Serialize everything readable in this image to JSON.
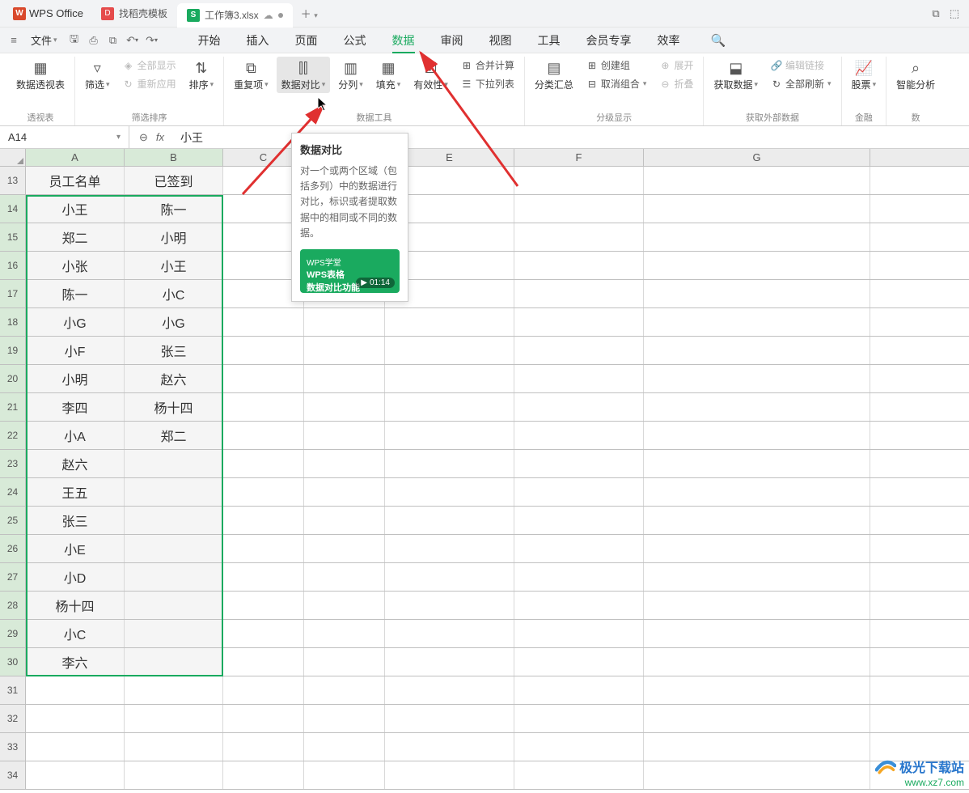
{
  "app": {
    "name": "WPS Office"
  },
  "tabs": {
    "find_template": "找稻壳模板",
    "file": {
      "name": "工作簿3.xlsx"
    }
  },
  "menubar": {
    "file": "文件",
    "items": [
      "开始",
      "插入",
      "页面",
      "公式",
      "数据",
      "审阅",
      "视图",
      "工具",
      "会员专享",
      "效率"
    ],
    "active_index": 4
  },
  "ribbon": {
    "groups": [
      {
        "label": "透视表",
        "buttons": [
          {
            "label": "数据透视表",
            "icon": "pivot"
          }
        ]
      },
      {
        "label": "筛选排序",
        "buttons": [
          {
            "label": "筛选",
            "icon": "filter",
            "dd": true
          },
          {
            "col": [
              {
                "label": "全部显示",
                "icon": "show-all",
                "disabled": true
              },
              {
                "label": "重新应用",
                "icon": "reapply",
                "disabled": true
              }
            ]
          },
          {
            "label": "排序",
            "icon": "sort",
            "dd": true
          }
        ]
      },
      {
        "label": "数据工具",
        "buttons": [
          {
            "label": "重复项",
            "icon": "dup",
            "dd": true
          },
          {
            "label": "数据对比",
            "icon": "compare",
            "dd": true,
            "active": true
          },
          {
            "label": "分列",
            "icon": "split",
            "dd": true
          },
          {
            "label": "填充",
            "icon": "fill",
            "dd": true
          },
          {
            "label": "有效性",
            "icon": "valid",
            "dd": true
          },
          {
            "col": [
              {
                "label": "合并计算",
                "icon": "merge"
              },
              {
                "label": "下拉列表",
                "icon": "dropdown"
              }
            ]
          }
        ]
      },
      {
        "label": "分级显示",
        "buttons": [
          {
            "label": "分类汇总",
            "icon": "subtotal"
          },
          {
            "col": [
              {
                "label": "创建组",
                "icon": "group"
              },
              {
                "label": "取消组合",
                "icon": "ungroup",
                "dd": true
              }
            ]
          },
          {
            "col": [
              {
                "label": "展开",
                "icon": "expand",
                "disabled": true
              },
              {
                "label": "折叠",
                "icon": "collapse",
                "disabled": true
              }
            ]
          }
        ]
      },
      {
        "label": "获取外部数据",
        "buttons": [
          {
            "label": "获取数据",
            "icon": "getdata",
            "dd": true
          },
          {
            "col": [
              {
                "label": "编辑链接",
                "icon": "editlink",
                "disabled": true
              },
              {
                "label": "全部刷新",
                "icon": "refresh",
                "dd": true
              }
            ]
          }
        ]
      },
      {
        "label": "金融",
        "buttons": [
          {
            "label": "股票",
            "icon": "stock",
            "dd": true
          }
        ]
      },
      {
        "label": "数",
        "buttons": [
          {
            "label": "智能分析",
            "icon": "smart"
          }
        ]
      }
    ]
  },
  "formula_bar": {
    "name_box": "A14",
    "value": "小王"
  },
  "spreadsheet": {
    "columns": [
      "A",
      "B",
      "C",
      "D",
      "E",
      "F",
      "G"
    ],
    "selected_cols": [
      "A",
      "B"
    ],
    "rows": [
      {
        "num": 13,
        "a": "员工名单",
        "b": "已签到",
        "header": true
      },
      {
        "num": 14,
        "a": "小王",
        "b": "陈一"
      },
      {
        "num": 15,
        "a": "郑二",
        "b": "小明"
      },
      {
        "num": 16,
        "a": "小张",
        "b": "小王"
      },
      {
        "num": 17,
        "a": "陈一",
        "b": "小C"
      },
      {
        "num": 18,
        "a": "小G",
        "b": "小G"
      },
      {
        "num": 19,
        "a": "小F",
        "b": "张三"
      },
      {
        "num": 20,
        "a": "小明",
        "b": "赵六"
      },
      {
        "num": 21,
        "a": "李四",
        "b": "杨十四"
      },
      {
        "num": 22,
        "a": "小A",
        "b": "郑二"
      },
      {
        "num": 23,
        "a": "赵六",
        "b": ""
      },
      {
        "num": 24,
        "a": "王五",
        "b": ""
      },
      {
        "num": 25,
        "a": "张三",
        "b": ""
      },
      {
        "num": 26,
        "a": "小E",
        "b": ""
      },
      {
        "num": 27,
        "a": "小D",
        "b": ""
      },
      {
        "num": 28,
        "a": "杨十四",
        "b": ""
      },
      {
        "num": 29,
        "a": "小C",
        "b": ""
      },
      {
        "num": 30,
        "a": "李六",
        "b": ""
      }
    ],
    "empty_rows": [
      31,
      32,
      33,
      34
    ]
  },
  "tooltip": {
    "title": "数据对比",
    "desc": "对一个或两个区域（包括多列）中的数据进行对比，标识或者提取数据中的相同或不同的数据。",
    "video": {
      "brand": "WPS学堂",
      "title1": "WPS表格",
      "title2": "数据对比功能",
      "time": "01:14"
    }
  },
  "watermark": {
    "line1": "极光下载站",
    "line2": "www.xz7.com"
  }
}
